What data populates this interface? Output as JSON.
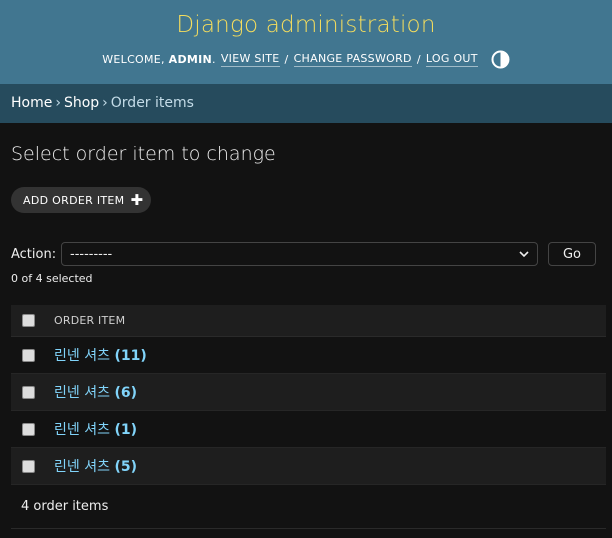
{
  "header": {
    "site_name": "Django administration",
    "welcome": "Welcome,",
    "username": "admin",
    "view_site": "View site",
    "change_password": "Change password",
    "log_out": "Log out",
    "theme_icon": "half-circle-contrast-icon"
  },
  "breadcrumbs": {
    "home": "Home",
    "app": "Shop",
    "model": "Order items",
    "separator": "›"
  },
  "main": {
    "title": "Select order item to change",
    "add_button": "Add order item",
    "action_label": "Action:",
    "action_selected": "---------",
    "go_button": "Go",
    "selected_count": "0 of 4 selected",
    "column_header": "Order item",
    "rows": [
      {
        "name": "린넨 셔츠",
        "qty": "(11)"
      },
      {
        "name": "린넨 셔츠",
        "qty": "(6)"
      },
      {
        "name": "린넨 셔츠",
        "qty": "(1)"
      },
      {
        "name": "린넨 셔츠",
        "qty": "(5)"
      }
    ],
    "paginator": "4 order items"
  },
  "colors": {
    "header_bg": "#417690",
    "site_name": "#f5dd5d",
    "breadcrumbs_bg": "#264b5d",
    "link": "#81d4fa",
    "body_bg": "#121212"
  }
}
